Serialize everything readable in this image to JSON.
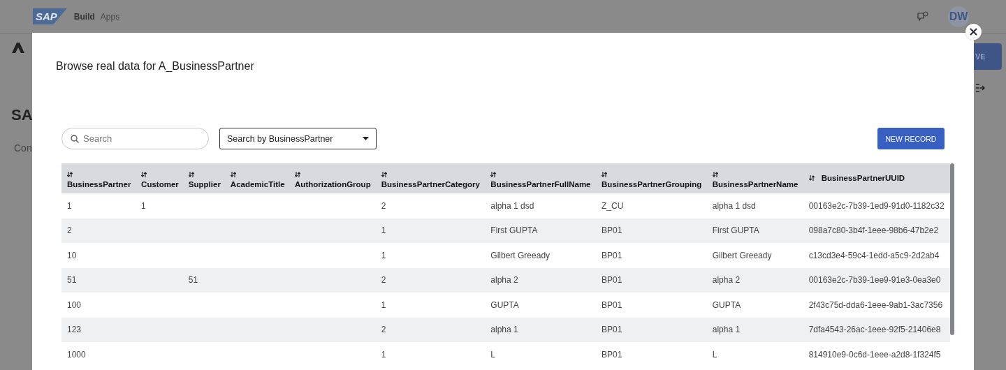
{
  "app_header": {
    "logo": "SAP",
    "product": "Build",
    "section": "Apps",
    "avatar": "DW"
  },
  "background": {
    "page_title": "SA",
    "tab": "Con",
    "save_button": "VE"
  },
  "dialog": {
    "title": "Browse real data for A_BusinessPartner",
    "search": {
      "placeholder": "Search"
    },
    "search_by": {
      "value": "Search by BusinessPartner"
    },
    "new_record_button": "NEW RECORD",
    "table": {
      "columns": [
        "BusinessPartner",
        "Customer",
        "Supplier",
        "AcademicTitle",
        "AuthorizationGroup",
        "BusinessPartnerCategory",
        "BusinessPartnerFullName",
        "BusinessPartnerGrouping",
        "BusinessPartnerName",
        "BusinessPartnerUUID"
      ],
      "rows": [
        [
          "1",
          "1",
          null,
          null,
          null,
          "2",
          "alpha 1 dsd",
          "Z_CU",
          "alpha 1 dsd",
          "00163e2c-7b39-1ed9-91d0-1182c32"
        ],
        [
          "2",
          null,
          null,
          null,
          null,
          "1",
          "First GUPTA",
          "BP01",
          "First GUPTA",
          "098a7c80-3b4f-1eee-98b6-47b2e2"
        ],
        [
          "10",
          null,
          null,
          null,
          null,
          "1",
          "Gilbert Greeady",
          "BP01",
          "Gilbert Greeady",
          "c13cd3e4-59c4-1edd-a5c9-2d2ab4"
        ],
        [
          "51",
          null,
          "51",
          null,
          null,
          "2",
          "alpha 2",
          "BP01",
          "alpha 2",
          "00163e2c-7b39-1ee9-91e3-0ea3e0"
        ],
        [
          "100",
          null,
          null,
          null,
          null,
          "1",
          "GUPTA",
          "BP01",
          "GUPTA",
          "2f43c75d-dda6-1eee-9ab1-3ac7356"
        ],
        [
          "123",
          null,
          null,
          null,
          null,
          "2",
          "alpha 1",
          "BP01",
          "alpha 1",
          "7dfa4543-26ac-1eee-92f5-21406e8"
        ],
        [
          "1000",
          null,
          null,
          null,
          null,
          "1",
          "L",
          "BP01",
          "L",
          "814910e9-0c6d-1eee-a2d8-1f324f5"
        ]
      ]
    }
  }
}
